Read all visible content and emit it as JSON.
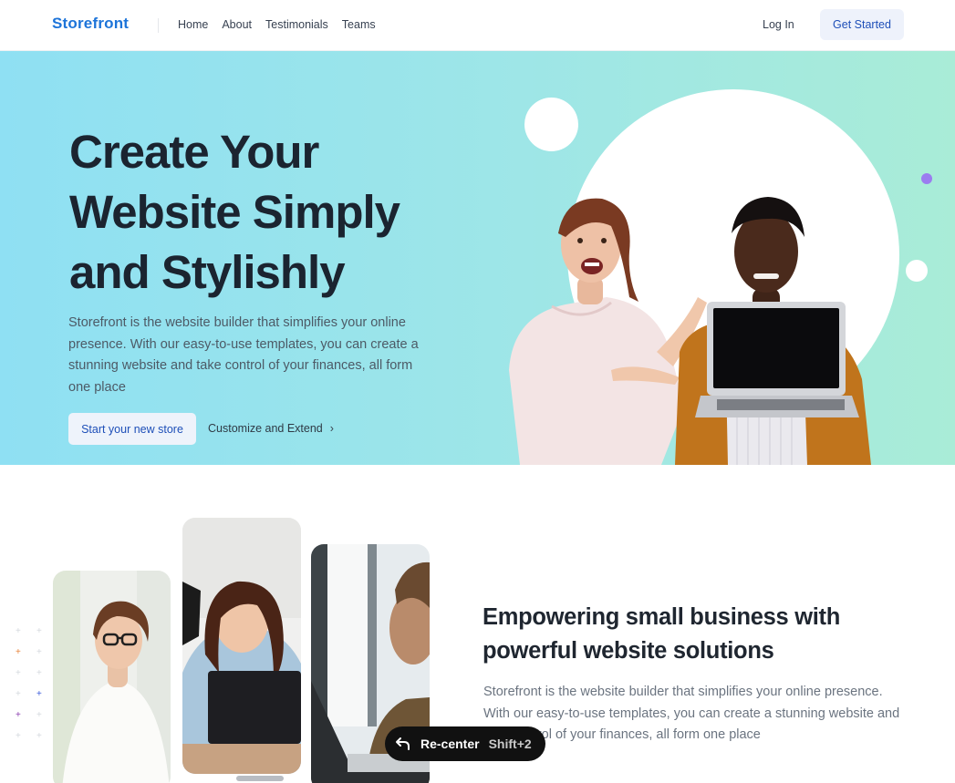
{
  "header": {
    "logo": "Storefront",
    "nav": [
      "Home",
      "About",
      "Testimonials",
      "Teams"
    ],
    "login_label": "Log In",
    "get_started_label": "Get Started"
  },
  "hero": {
    "title_lines": [
      "Create Your",
      "Website Simply",
      "and Stylishly"
    ],
    "description": "Storefront is the website builder that simplifies your online presence. With our easy-to-use templates, you can create a stunning website and take control of your finances, all form one place",
    "primary_button": "Start your new store",
    "secondary_link": "Customize and Extend",
    "secondary_icon": "chevron-right-icon"
  },
  "section": {
    "title": "Empowering small business with powerful website solutions",
    "description": "Storefront is the website builder that simplifies your online presence. With our easy-to-use templates, you can create a stunning website and take control of your finances, all form one place"
  },
  "overlay": {
    "recenter_label": "Re-center",
    "shortcut": "Shift+2",
    "icon": "undo-arrow-icon"
  },
  "colors": {
    "brand": "#1d74d9",
    "hero_gradient_start": "#8fe0f3",
    "hero_gradient_end": "#a9ecd7",
    "accent_dot": "#9b7cf0"
  }
}
